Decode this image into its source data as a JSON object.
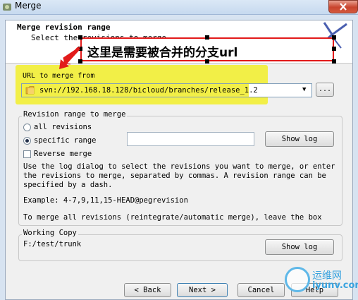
{
  "window": {
    "title": "Merge"
  },
  "header": {
    "title": "Merge revision range",
    "subtitle": "Select the revisions to merge."
  },
  "annotation": {
    "text": "这里是需要被合并的分支url",
    "color": "#e21a1a"
  },
  "url_section": {
    "label": "URL to merge from",
    "value": "svn://192.168.18.128/bicloud/branches/release_1.2",
    "browse_label": "...",
    "highlight_color": "#f2ef47"
  },
  "revision_range": {
    "group_label": "Revision range to merge",
    "option_all": "all revisions",
    "option_specific": "specific range",
    "selected": "specific range",
    "range_value": "",
    "show_log_label": "Show log",
    "reverse_label": "Reverse merge",
    "reverse_checked": false,
    "help_lines": [
      "Use the log dialog to select the revisions you want to merge, or enter",
      "the revisions to merge, separated by commas. A revision range can be",
      "specified by a dash.",
      "",
      "Example: 4-7,9,11,15-HEAD@pegrevision",
      "",
      "To merge all revisions (reintegrate/automatic merge), leave the box"
    ]
  },
  "working_copy": {
    "group_label": "Working Copy",
    "path": "F:/test/trunk",
    "show_log_label": "Show log"
  },
  "buttons": {
    "back": "< Back",
    "next": "Next >",
    "cancel": "Cancel",
    "help": "Help"
  },
  "watermark": {
    "text_cn": "运维网",
    "text_en": "iyunv.com"
  }
}
